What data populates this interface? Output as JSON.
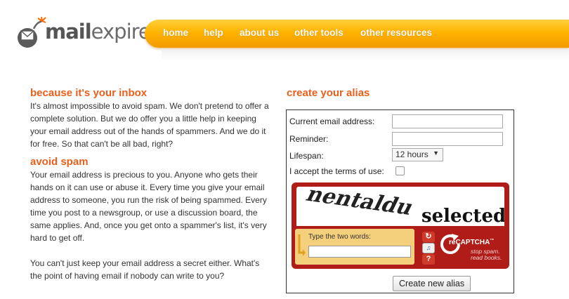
{
  "logo": {
    "bold": "mail",
    "light": "expire"
  },
  "nav": [
    {
      "label": "home"
    },
    {
      "label": "help"
    },
    {
      "label": "about us"
    },
    {
      "label": "other tools"
    },
    {
      "label": "other resources"
    }
  ],
  "left": {
    "heading1": "because it's your inbox",
    "para1": "It's almost impossible to avoid spam. We don't pretend to offer a complete solution. But we do offer you a little help in keeping your email address out of the hands of spammers. And we do it for free. So that can't be all bad, right?",
    "heading2": "avoid spam",
    "para2": "Your email address is precious to you. Anyone who gets their hands on it can use or abuse it. Every time you give your email address to someone, you run the risk of being spammed. Every time you post to a newsgroup, or use a discussion board, the same applies. And, once you get onto a spammer's list, it's very hard to get off.",
    "para3": "You can't just keep your email address a secret either. What's the point of having email if nobody can write to you?"
  },
  "form": {
    "title": "create your alias",
    "email_label": "Current email address:",
    "email_value": "",
    "reminder_label": "Reminder:",
    "reminder_value": "",
    "lifespan_label": "Lifespan:",
    "lifespan_value": "12 hours",
    "terms_label": "I accept the terms of use:",
    "terms_checked": false,
    "submit_label": "Create new alias"
  },
  "captcha": {
    "word1": "nentaldu",
    "word2": "selected",
    "prompt": "Type the two words:",
    "logo_prefix": "re",
    "logo_main": "CAPTCHA",
    "tm": "™",
    "tagline1": "stop spam.",
    "tagline2": "read books."
  },
  "colors": {
    "accent_orange": "#e8601c",
    "nav_gold": "#ffb300",
    "captcha_red": "#b01c17",
    "captcha_panel": "#f4d07c"
  }
}
